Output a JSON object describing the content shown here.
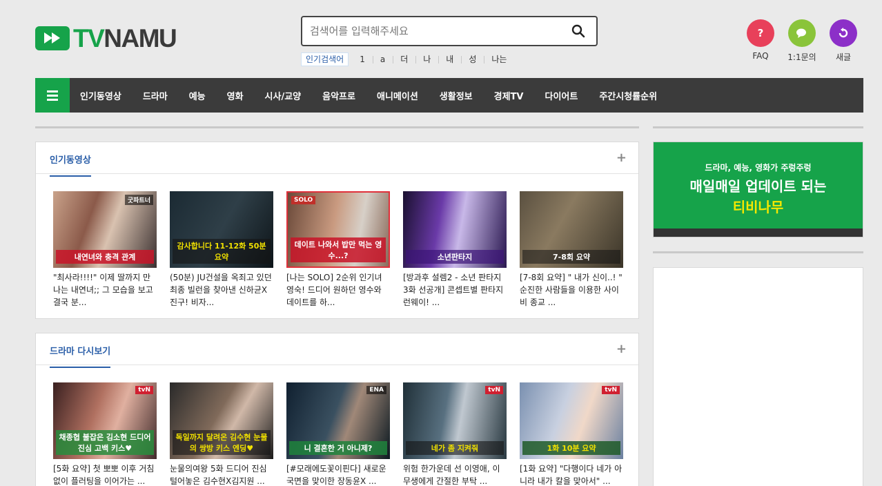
{
  "brand": {
    "tv": "TV",
    "namu": "NAMU",
    "accent": "#16a34a"
  },
  "search": {
    "placeholder": "검색어를 입력해주세요",
    "icon": "search-icon"
  },
  "hot_keywords": {
    "label": "인기검색어",
    "items": [
      "1",
      "a",
      "더",
      "나",
      "내",
      "성",
      "나는"
    ]
  },
  "top_icons": [
    {
      "label": "FAQ",
      "icon": "question-icon",
      "color": "#e8405a"
    },
    {
      "label": "1:1문의",
      "icon": "chat-icon",
      "color": "#8ac43a"
    },
    {
      "label": "새글",
      "icon": "refresh-icon",
      "color": "#8c2fc8"
    }
  ],
  "nav": {
    "items": [
      "인기동영상",
      "드라마",
      "예능",
      "영화",
      "시사/교양",
      "음악프로",
      "애니메이션",
      "생활정보",
      "경제TV",
      "다이어트",
      "주간시청률순위"
    ]
  },
  "sections": [
    {
      "title": "인기동영상",
      "plus": "+",
      "cards": [
        {
          "title": "\"최사라!!!!\" 이제 딸까지 만나는 내연녀;; 그 모습을 보고 결국 분...",
          "caption": "내연녀와 충격 관계",
          "tag": "굿파트너"
        },
        {
          "title": "(50분) JU건설을 옥죄고 있던 최종 빌런을 찾아낸 신하균X진구! 비자...",
          "caption": "감사합니다 11-12화 50분 요약",
          "tag": ""
        },
        {
          "title": "[나는 SOLO] 2순위 인기녀 영숙! 드디어 원하던 영수와 데이트를 하...",
          "caption": "데이트 나와서 밥만 먹는 영수...?",
          "tag": "SOLO"
        },
        {
          "title": "[방과후 설렘2 - 소년 판타지 3화 선공개] 콘셉트별 판타지 런웨이! ...",
          "caption": "소년판타지",
          "tag": ""
        },
        {
          "title": "[7-8회 요약] \" 내가 신이..! \" 순진한 사람들을 이용한 사이비 종교 ...",
          "caption": "7-8회 요약",
          "tag": ""
        }
      ]
    },
    {
      "title": "드라마 다시보기",
      "plus": "+",
      "cards": [
        {
          "title": "[5화 요약] 첫 뽀뽀 이후 거침없이 플러팅을 이어가는 ...",
          "caption": "채종협 불잡은 김소현 드디어 진심 고백 키스♥",
          "tag": "tvN"
        },
        {
          "title": "눈물의여왕 5화 드디어 진심 털어놓은 김수현X김지원 ...",
          "caption": "독일까지 달려온 김수현 눈물의 쌍방 키스 엔딩♥",
          "tag": ""
        },
        {
          "title": "[#모래에도꽃이핀다] 새로운 국면을 맞이한 장동윤X ...",
          "caption": "니 결혼한 거 아니제?",
          "tag": "ENA"
        },
        {
          "title": "위험 한가운데 선 이영애, 이무생에게 간절한 부탁 ...",
          "caption": "네가 좀 지켜줘",
          "tag": "tvN"
        },
        {
          "title": "[1화 요약] \"다행이다 네가 아니라 내가 칼을 맞아서\" ...",
          "caption": "1화 10분 요약",
          "tag": "tvN"
        }
      ]
    }
  ],
  "banner": {
    "line1": "드라마, 예능, 영화가 주렁주렁",
    "line2": "매일매일 업데이트 되는",
    "line3": "티비나무"
  }
}
